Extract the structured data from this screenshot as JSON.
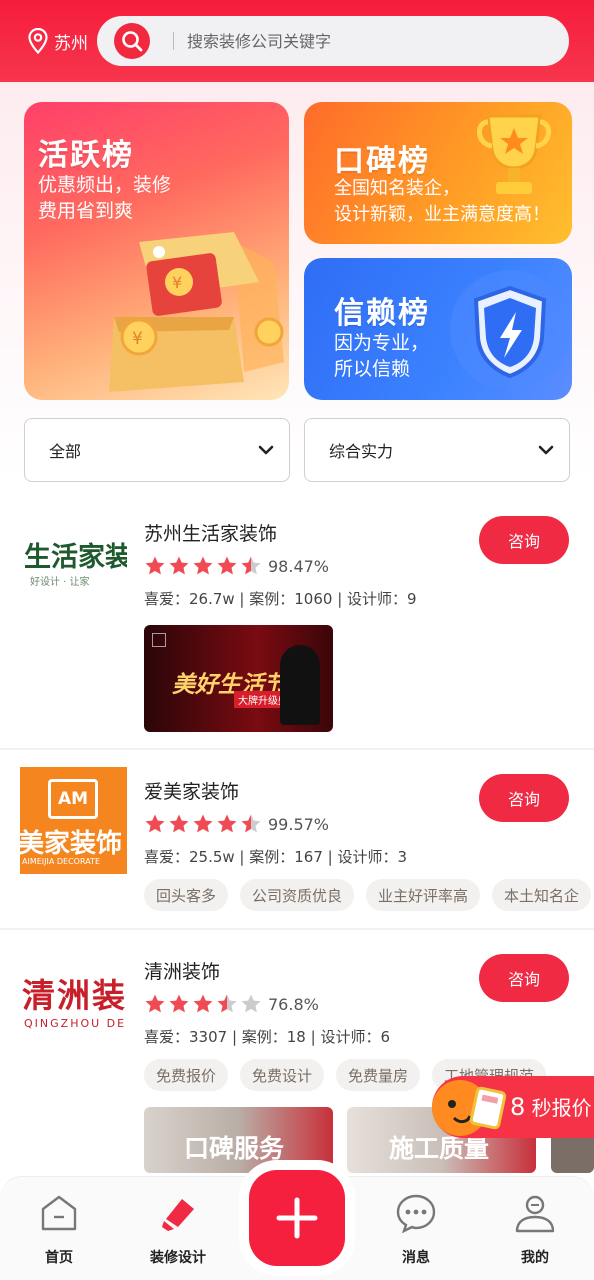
{
  "header": {
    "location": "苏州",
    "search_placeholder": "搜索装修公司关键字"
  },
  "banners": {
    "active": {
      "title": "活跃榜",
      "desc_line1": "优惠频出，装修",
      "desc_line2": "费用省到爽"
    },
    "praise": {
      "title": "口碑榜",
      "desc_line1": "全国知名装企，",
      "desc_line2": "设计新颖，业主满意度高！"
    },
    "trust": {
      "title": "信赖榜",
      "desc_line1": "因为专业，",
      "desc_line2": "所以信赖"
    }
  },
  "filters": {
    "category": "全部",
    "sort": "综合实力"
  },
  "companies": [
    {
      "name": "苏州生活家装饰",
      "rating": "98.47%",
      "stars": 4.5,
      "meta": "喜爱：26.7w | 案例：1060 | 设计师：9",
      "logo_text": "生活家装",
      "logo_sub": "好设计 · 让家",
      "promo_text": "美好生活节",
      "promo_sub": "大牌升级盛惠",
      "consult_label": "咨询"
    },
    {
      "name": "爱美家装饰",
      "rating": "99.57%",
      "stars": 4.5,
      "meta": "喜爱：25.5w | 案例：167 | 设计师：3",
      "logo_text": "美家装饰",
      "logo_badge": "AM",
      "logo_sub": "AIMEIJIA DECORATE",
      "tags": [
        "回头客多",
        "公司资质优良",
        "业主好评率高",
        "本土知名企"
      ],
      "consult_label": "咨询"
    },
    {
      "name": "清洲装饰",
      "rating": "76.8%",
      "stars": 3.5,
      "meta": "喜爱：3307 | 案例：18 | 设计师：6",
      "logo_text": "清洲装",
      "logo_sub": "QINGZHOU DE",
      "tags": [
        "免费报价",
        "免费设计",
        "免费量房",
        "工地管理规范"
      ],
      "promo1": "口碑服务",
      "promo2": "施工质量",
      "consult_label": "咨询"
    }
  ],
  "quote": {
    "seconds": "8",
    "label": "秒报价"
  },
  "nav": {
    "home": "首页",
    "design": "装修设计",
    "messages": "消息",
    "mine": "我的"
  },
  "colors": {
    "brand": "#f02a43",
    "star": "#f04a55",
    "star_empty": "#cccccc"
  }
}
